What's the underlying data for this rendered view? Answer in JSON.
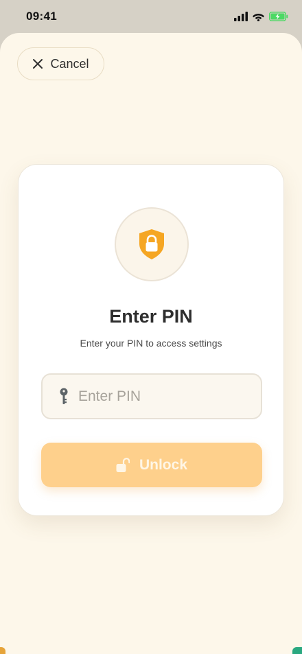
{
  "status_bar": {
    "time": "09:41",
    "icons": [
      "cellular-signal-icon",
      "wifi-icon",
      "battery-charging-icon"
    ]
  },
  "header": {
    "cancel_label": "Cancel",
    "cancel_icon": "close-icon"
  },
  "card": {
    "icon": "shield-lock-icon",
    "title": "Enter PIN",
    "subtitle": "Enter your PIN to access settings",
    "pin_input": {
      "icon": "key-icon",
      "placeholder": "Enter PIN",
      "value": ""
    },
    "unlock": {
      "icon": "unlock-icon",
      "label": "Unlock",
      "disabled": true
    }
  },
  "colors": {
    "background": "#fdf7ea",
    "accent": "#f5a623",
    "button_disabled": "#fed08c",
    "battery": "#4cd964"
  }
}
